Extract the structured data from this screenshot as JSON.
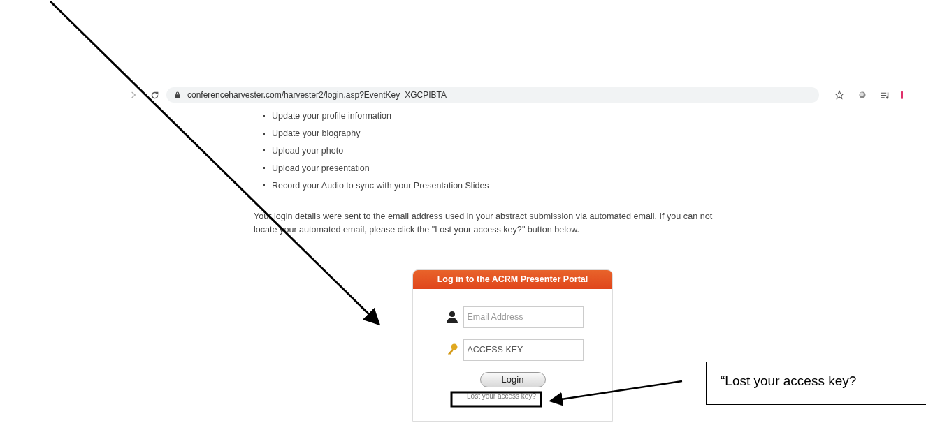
{
  "browser": {
    "url": "conferenceharvester.com/harvester2/login.asp?EventKey=XGCPIBTA"
  },
  "bullets": [
    "Update your profile information",
    "Update your biography",
    "Upload your photo",
    "Upload your presentation",
    "Record your Audio to sync with your Presentation Slides"
  ],
  "intro": "Your login details were sent to the email address used in your abstract submission via automated email. If you can not locate your automated email, please click the \"Lost your access key?\" button below.",
  "login": {
    "title": "Log in to the ACRM Presenter Portal",
    "email_placeholder": "Email Address",
    "key_placeholder": "ACCESS KEY",
    "button": "Login",
    "lost_link": "Lost your access key?"
  },
  "callout": {
    "text": "“Lost your access key?"
  }
}
